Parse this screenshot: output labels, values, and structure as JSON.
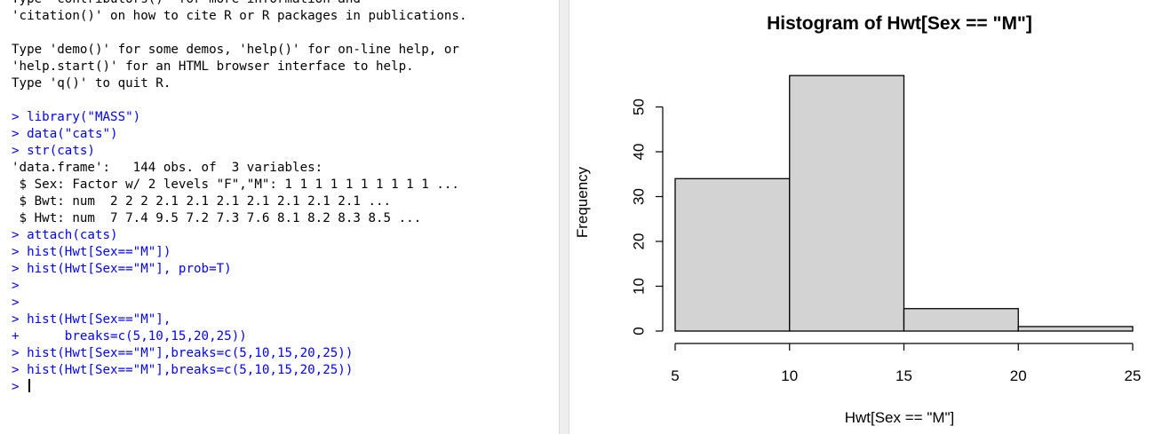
{
  "console": {
    "lines": [
      {
        "type": "out",
        "text": "Type 'contributors()' for more information and"
      },
      {
        "type": "out",
        "text": "'citation()' on how to cite R or R packages in publications."
      },
      {
        "type": "out",
        "text": ""
      },
      {
        "type": "out",
        "text": "Type 'demo()' for some demos, 'help()' for on-line help, or"
      },
      {
        "type": "out",
        "text": "'help.start()' for an HTML browser interface to help."
      },
      {
        "type": "out",
        "text": "Type 'q()' to quit R."
      },
      {
        "type": "out",
        "text": ""
      },
      {
        "type": "cmd",
        "prompt": "> ",
        "text": "library(\"MASS\")"
      },
      {
        "type": "cmd",
        "prompt": "> ",
        "text": "data(\"cats\")"
      },
      {
        "type": "cmd",
        "prompt": "> ",
        "text": "str(cats)"
      },
      {
        "type": "out",
        "text": "'data.frame':   144 obs. of  3 variables:"
      },
      {
        "type": "out",
        "text": " $ Sex: Factor w/ 2 levels \"F\",\"M\": 1 1 1 1 1 1 1 1 1 1 ..."
      },
      {
        "type": "out",
        "text": " $ Bwt: num  2 2 2 2.1 2.1 2.1 2.1 2.1 2.1 2.1 ..."
      },
      {
        "type": "out",
        "text": " $ Hwt: num  7 7.4 9.5 7.2 7.3 7.6 8.1 8.2 8.3 8.5 ..."
      },
      {
        "type": "cmd",
        "prompt": "> ",
        "text": "attach(cats)"
      },
      {
        "type": "cmd",
        "prompt": "> ",
        "text": "hist(Hwt[Sex==\"M\"])"
      },
      {
        "type": "cmd",
        "prompt": "> ",
        "text": "hist(Hwt[Sex==\"M\"], prob=T)"
      },
      {
        "type": "cmd",
        "prompt": "> ",
        "text": ""
      },
      {
        "type": "cmd",
        "prompt": "> ",
        "text": ""
      },
      {
        "type": "cmd",
        "prompt": "> ",
        "text": "hist(Hwt[Sex==\"M\"],"
      },
      {
        "type": "cmd",
        "prompt": "+ ",
        "text": "     breaks=c(5,10,15,20,25))"
      },
      {
        "type": "cmd",
        "prompt": "> ",
        "text": "hist(Hwt[Sex==\"M\"],breaks=c(5,10,15,20,25))"
      },
      {
        "type": "cmd",
        "prompt": "> ",
        "text": "hist(Hwt[Sex==\"M\"],breaks=c(5,10,15,20,25))"
      }
    ],
    "input_prompt": "> "
  },
  "chart_data": {
    "type": "bar",
    "title": "Histogram of Hwt[Sex == \"M\"]",
    "xlabel": "Hwt[Sex == \"M\"]",
    "ylabel": "Frequency",
    "bins": [
      {
        "from": 5,
        "to": 10,
        "count": 34
      },
      {
        "from": 10,
        "to": 15,
        "count": 57
      },
      {
        "from": 15,
        "to": 20,
        "count": 5
      },
      {
        "from": 20,
        "to": 25,
        "count": 1
      }
    ],
    "xlim": [
      5,
      25
    ],
    "ylim": [
      0,
      57
    ],
    "x_ticks": [
      5,
      10,
      15,
      20,
      25
    ],
    "y_ticks": [
      0,
      10,
      20,
      30,
      40,
      50
    ],
    "bar_fill": "#d3d3d3",
    "bar_stroke": "#000000"
  }
}
